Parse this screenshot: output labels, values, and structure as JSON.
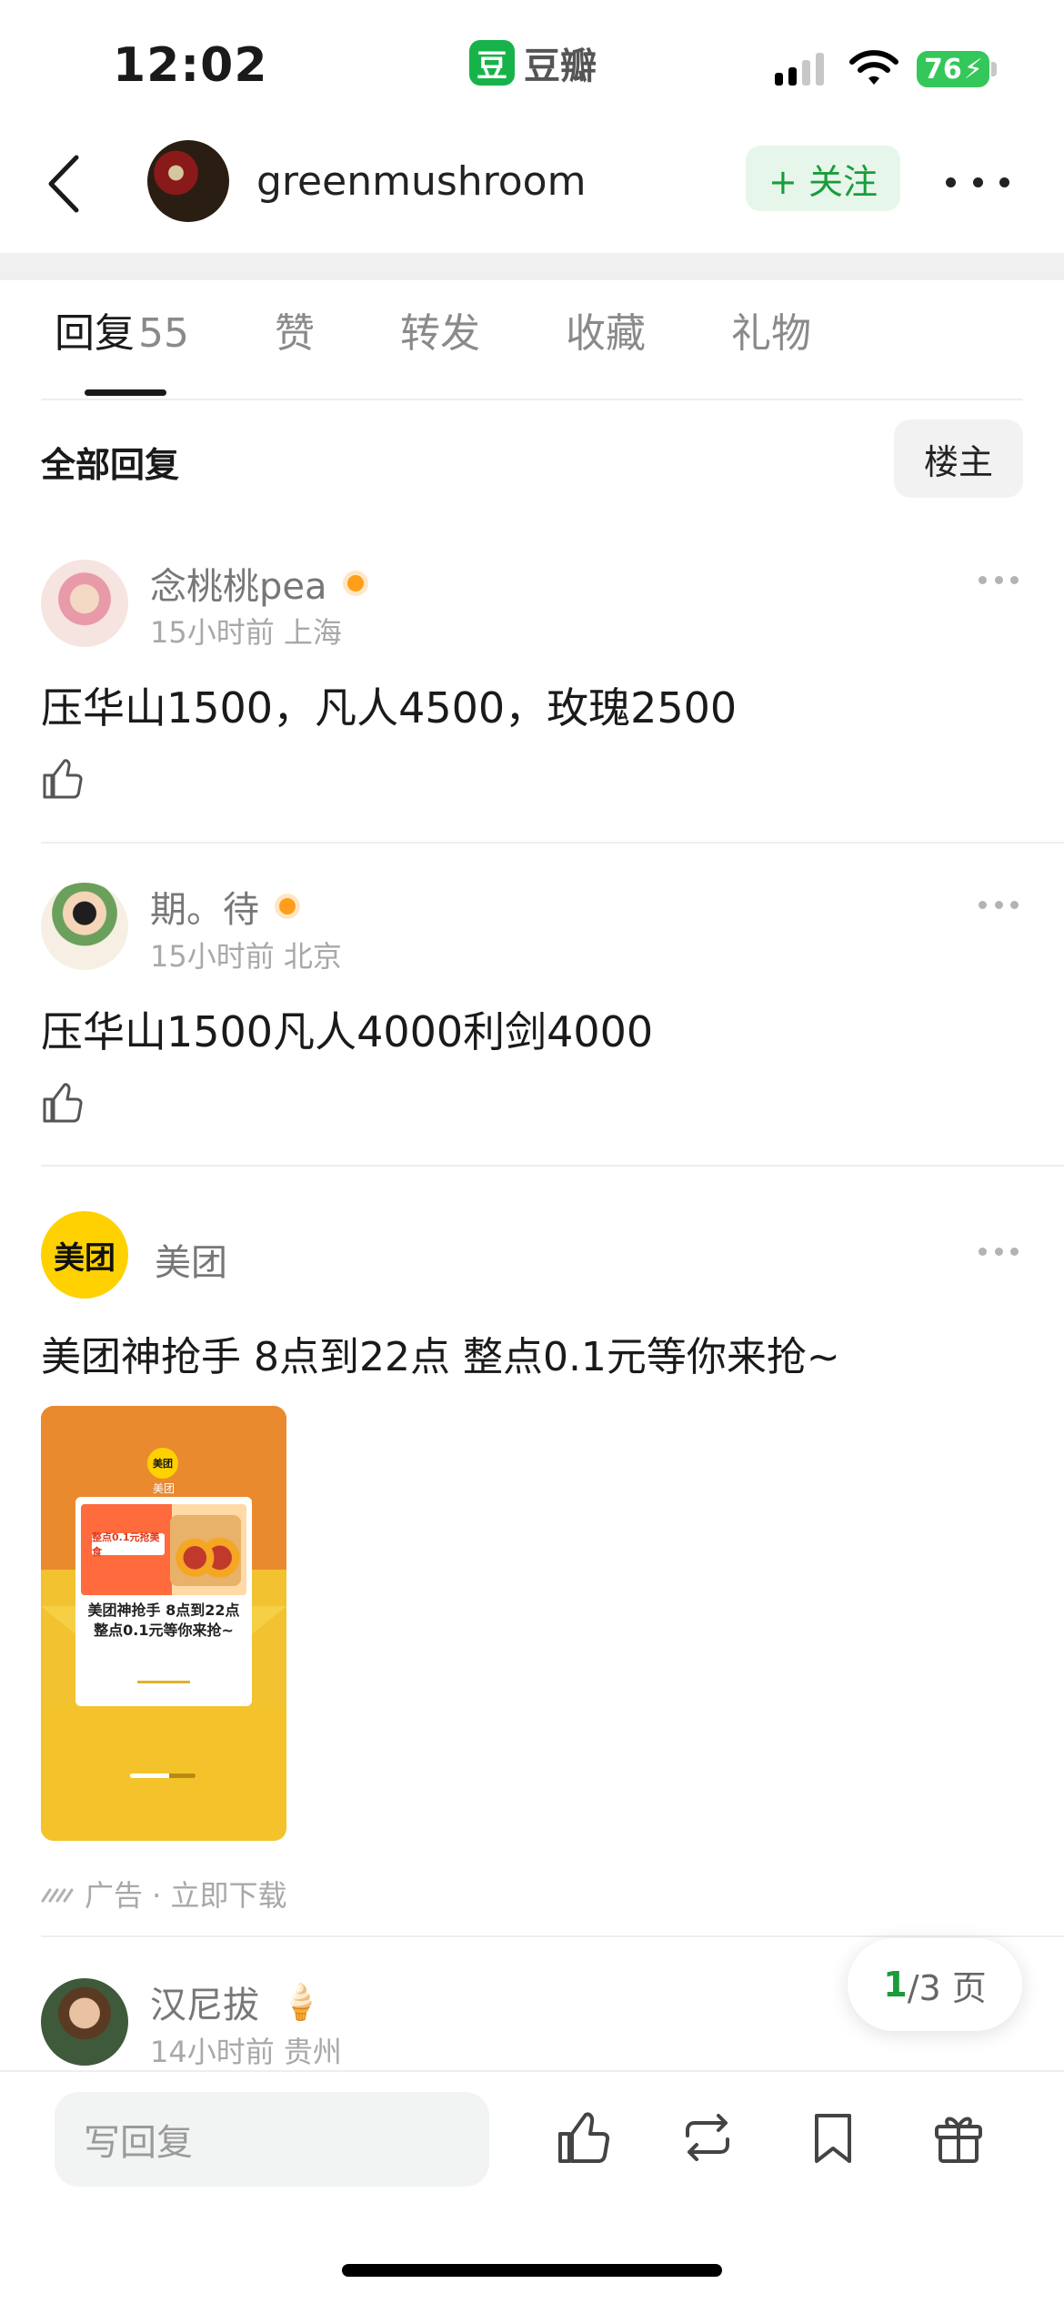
{
  "status_bar": {
    "time": "12:02",
    "app_logo_char": "豆",
    "app_name": "豆瓣",
    "battery": "76"
  },
  "header": {
    "username": "greenmushroom",
    "follow_label": "+ 关注"
  },
  "tabs": [
    {
      "label": "回复",
      "count": "55"
    },
    {
      "label": "赞"
    },
    {
      "label": "转发"
    },
    {
      "label": "收藏"
    },
    {
      "label": "礼物"
    }
  ],
  "filter": {
    "all_label": "全部回复",
    "owner_label": "楼主"
  },
  "comments": [
    {
      "name": "念桃桃pea",
      "meta": "15小时前 上海",
      "text": "压华山1500，凡人4500，玫瑰2500"
    },
    {
      "name": "期。待",
      "meta": "15小时前 北京",
      "text": "压华山1500凡人4000利剑4000"
    },
    {
      "name": "汉尼拔",
      "meta": "14小时前 贵州"
    }
  ],
  "ad": {
    "logo_text": "美团",
    "name": "美团",
    "text": "美团神抢手 8点到22点 整点0.1元等你来抢~",
    "card_logo": "美团",
    "card_name": "美团",
    "card_banner": "整点0.1元抢美食",
    "card_caption": "美团神抢手 8点到22点 整点0.1元等你来抢~",
    "footer": "广告 · 立即下载"
  },
  "pagination": {
    "current": "1",
    "rest": "/3 页"
  },
  "bottom_bar": {
    "reply_placeholder": "写回复"
  },
  "colors": {
    "accent_green": "#1a9c3b",
    "online_orange": "#ff9e1a",
    "meituan_yellow": "#ffd100"
  }
}
